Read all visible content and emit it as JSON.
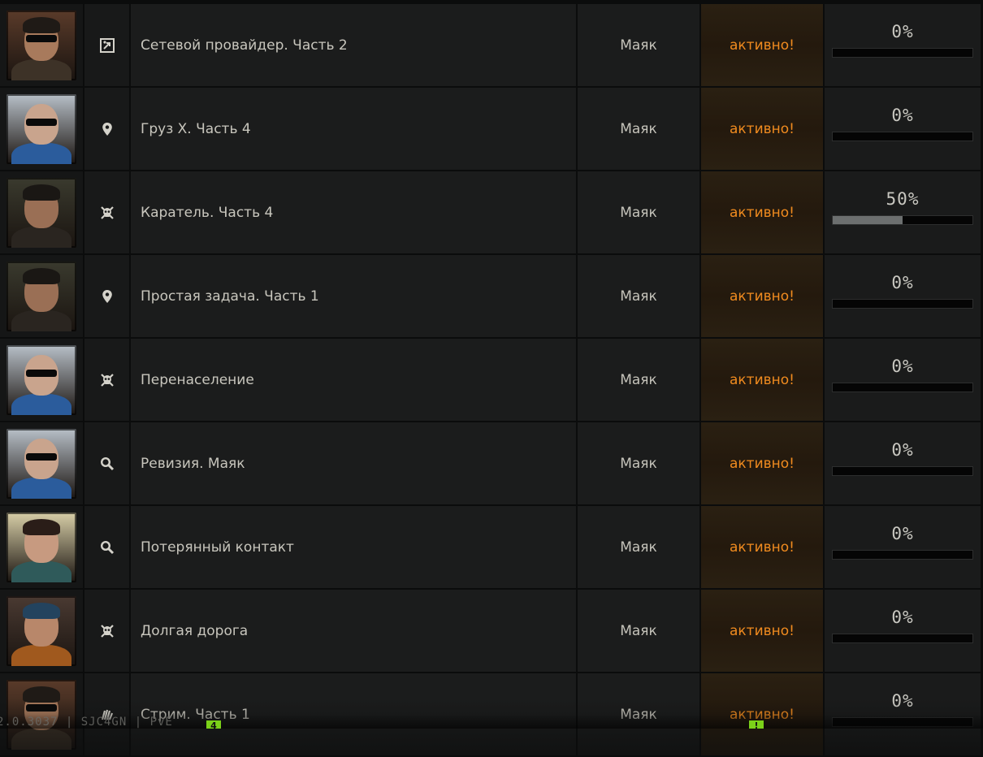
{
  "quests": [
    {
      "name": "Сетевой провайдер. Часть 2",
      "location": "Маяк",
      "status": "активно!",
      "progress": "0%",
      "progress_value": 0,
      "trader": "mechanic",
      "icon": "exit-icon",
      "portrait": {
        "skin": "#a87a5c",
        "hair": "#1f1a16",
        "body": "#3d3227",
        "bg": "#5a3b2a",
        "glasses": true
      }
    },
    {
      "name": "Груз X. Часть 4",
      "location": "Маяк",
      "status": "активно!",
      "progress": "0%",
      "progress_value": 0,
      "trader": "peacekeeper",
      "icon": "location-pin-icon",
      "portrait": {
        "skin": "#c9a48d",
        "hair": "#c9a48d",
        "body": "#2b5c9c",
        "bg": "#b8c0c8",
        "glasses": true
      }
    },
    {
      "name": "Каратель. Часть 4",
      "location": "Маяк",
      "status": "активно!",
      "progress": "50%",
      "progress_value": 0.5,
      "trader": "prapor",
      "icon": "skull-icon",
      "portrait": {
        "skin": "#9a6f55",
        "hair": "#1a1714",
        "body": "#2a2520",
        "bg": "#3a3a2e",
        "glasses": false
      }
    },
    {
      "name": "Простая задача. Часть 1",
      "location": "Маяк",
      "status": "активно!",
      "progress": "0%",
      "progress_value": 0,
      "trader": "prapor",
      "icon": "location-pin-icon",
      "portrait": {
        "skin": "#9a6f55",
        "hair": "#1a1714",
        "body": "#2a2520",
        "bg": "#3a3a2e",
        "glasses": false
      }
    },
    {
      "name": "Перенаселение",
      "location": "Маяк",
      "status": "активно!",
      "progress": "0%",
      "progress_value": 0,
      "trader": "peacekeeper",
      "icon": "skull-icon",
      "portrait": {
        "skin": "#c9a48d",
        "hair": "#c9a48d",
        "body": "#2b5c9c",
        "bg": "#b8c0c8",
        "glasses": true
      }
    },
    {
      "name": "Ревизия. Маяк",
      "location": "Маяк",
      "status": "активно!",
      "progress": "0%",
      "progress_value": 0,
      "trader": "peacekeeper",
      "icon": "search-icon",
      "portrait": {
        "skin": "#c9a48d",
        "hair": "#c9a48d",
        "body": "#2b5c9c",
        "bg": "#b8c0c8",
        "glasses": true
      }
    },
    {
      "name": "Потерянный контакт",
      "location": "Маяк",
      "status": "активно!",
      "progress": "0%",
      "progress_value": 0,
      "trader": "therapist",
      "icon": "search-icon",
      "portrait": {
        "skin": "#c79a80",
        "hair": "#2a1d18",
        "body": "#2f5a5a",
        "bg": "#d8cfa8",
        "glasses": false
      }
    },
    {
      "name": "Долгая дорога",
      "location": "Маяк",
      "status": "активно!",
      "progress": "0%",
      "progress_value": 0,
      "trader": "ragman",
      "icon": "skull-icon",
      "portrait": {
        "skin": "#b8876a",
        "hair": "#23435e",
        "body": "#a0591e",
        "bg": "#4a3a32",
        "glasses": false
      }
    },
    {
      "name": "Стрим. Часть 1",
      "location": "Маяк",
      "status": "активно!",
      "progress": "0%",
      "progress_value": 0,
      "trader": "mechanic",
      "icon": "hand-icon",
      "portrait": {
        "skin": "#a87a5c",
        "hair": "#1f1a16",
        "body": "#3d3227",
        "bg": "#5a3b2a",
        "glasses": true
      }
    }
  ],
  "footer": {
    "version": "2.0.3037 | SJC4GN | PvE",
    "marker_left": "4",
    "marker_right": "!"
  },
  "colors": {
    "status_active": "#f08b1f",
    "background": "#0b0c0c",
    "cell": "#1b1c1c",
    "progress_fill": "#6c6f6f"
  }
}
